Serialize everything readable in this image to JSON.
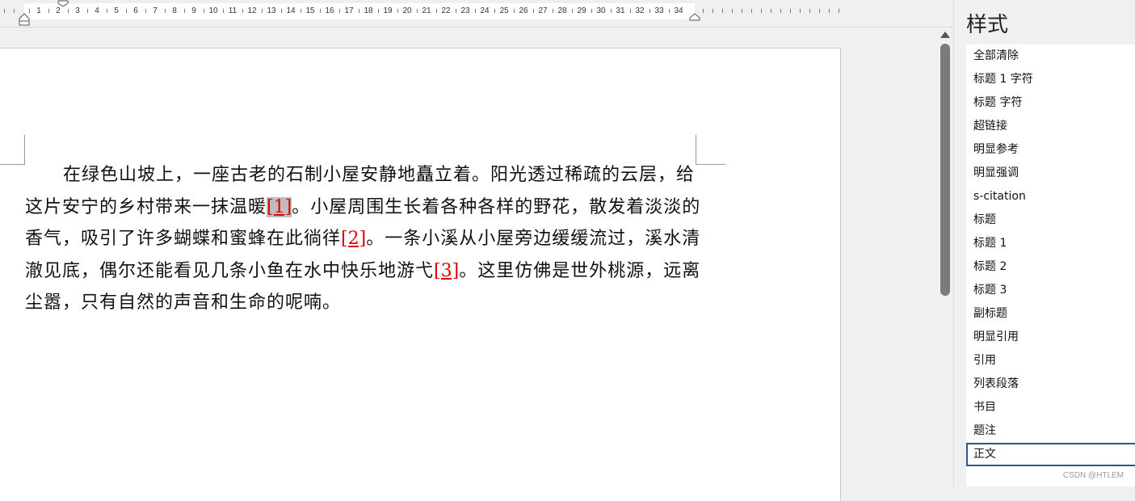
{
  "ruler": {
    "numbers": [
      "1",
      "2",
      "3",
      "4",
      "5",
      "6",
      "7",
      "8",
      "9",
      "10",
      "11",
      "12",
      "13",
      "14",
      "15",
      "16",
      "17",
      "18",
      "19",
      "20",
      "21",
      "22",
      "23",
      "24",
      "25",
      "26",
      "27",
      "28",
      "29",
      "30",
      "31",
      "32",
      "33",
      "34"
    ]
  },
  "document": {
    "paragraph": {
      "seg1": "在绿色山坡上，一座古老的石制小屋安静地矗立着。阳光透过稀疏的云层，给这片安宁的乡村带来一抹温暖",
      "cite1": "[1]",
      "seg2": "。小屋周围生长着各种各样的野花，散发着淡淡的香气，吸引了许多蝴蝶和蜜蜂在此徜徉",
      "cite2": "[2]",
      "seg3": "。一条小溪从小屋旁边缓缓流过，溪水清澈见底，偶尔还能看见几条小鱼在水中快乐地游弋",
      "cite3": "[3]",
      "seg4": "。这里仿佛是世外桃源，远离尘嚣，只有自然的声音和生命的呢喃。"
    }
  },
  "styles_pane": {
    "title": "样式",
    "items": [
      {
        "label": "全部清除"
      },
      {
        "label": "标题 1 字符"
      },
      {
        "label": "标题 字符"
      },
      {
        "label": "超链接"
      },
      {
        "label": "明显参考"
      },
      {
        "label": "明显强调"
      },
      {
        "label": "s-citation"
      },
      {
        "label": "标题"
      },
      {
        "label": "标题 1"
      },
      {
        "label": "标题 2"
      },
      {
        "label": "标题 3"
      },
      {
        "label": "副标题"
      },
      {
        "label": "明显引用"
      },
      {
        "label": "引用"
      },
      {
        "label": "列表段落"
      },
      {
        "label": "书目"
      },
      {
        "label": "题注"
      },
      {
        "label": "正文"
      }
    ],
    "selected_item": "正文"
  },
  "watermark": "CSDN @HTLEM",
  "colors": {
    "citation": "#e00000",
    "selection_border": "#2b579a",
    "highlight": "#bdbdbd"
  }
}
